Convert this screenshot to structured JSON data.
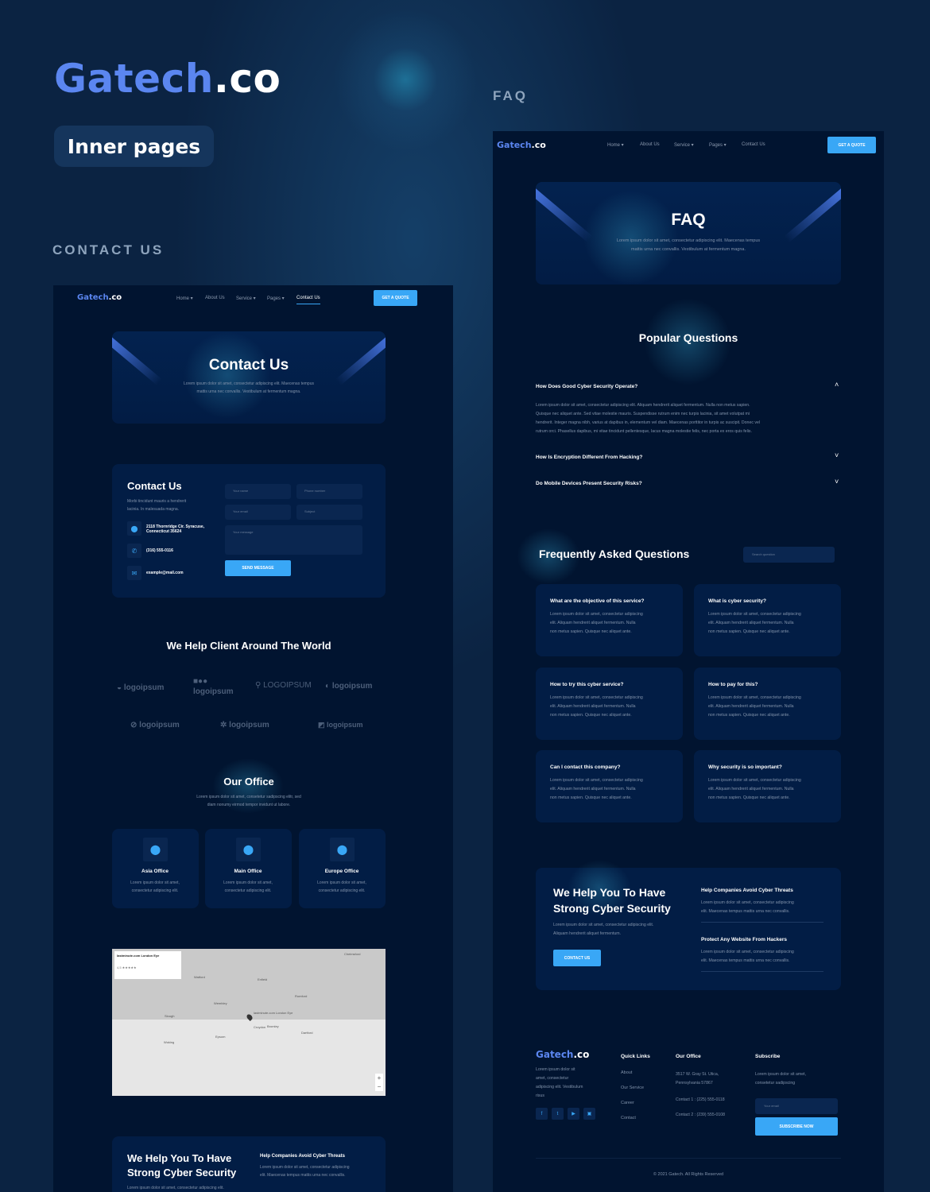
{
  "showcase": {
    "brand_a": "Gatech",
    "brand_b": ".co",
    "badge": "Inner pages",
    "section_contact": "CONTACT US",
    "section_faq": "FAQ"
  },
  "colors": {
    "accent": "#39a7f6",
    "brand_blue": "#5b86f0",
    "bg": "#011430",
    "card": "#021d45"
  },
  "nav": {
    "logo_a": "Gatech",
    "logo_b": ".co",
    "items": [
      "Home",
      "About Us",
      "Service",
      "Pages",
      "Contact Us"
    ],
    "cta": "GET A QUOTE"
  },
  "contact": {
    "hero_title": "Contact Us",
    "hero_text_1": "Lorem ipsum dolor sit amet, consectetur adipiscing elit. Maecenas tempus",
    "hero_text_2": "mattis urna nec convallis. Vestibulum at fermentum magna.",
    "form_title": "Contact Us",
    "form_text_1": "Morbi tincidunt mauris a hendrerit",
    "form_text_2": "lacinia. In malesuada magna.",
    "address_1": "2118 Thornridge Cir. Syracuse,",
    "address_2": "Connecticut 35624",
    "phone": "(316) 555-0116",
    "email": "example@mail.com",
    "ph_name": "Your name",
    "ph_phone": "Phone number",
    "ph_email": "Your email",
    "ph_subject": "Subject",
    "ph_message": "Your message",
    "send": "SEND MESSAGE",
    "clients_title": "We Help Client Around The World",
    "logos": [
      "logoipsum",
      "logoipsum",
      "LOGOIPSUM",
      "logoipsum",
      "logoipsum",
      "logoipsum",
      "logoipsum"
    ],
    "office_title": "Our Office",
    "office_text_1": "Lorem ipsum dolor sit amet, consetetur sadipscing elitr, sed",
    "office_text_2": "diam nonumy eirmod tempor invidunt ut labore.",
    "offices": [
      {
        "name": "Asia Office",
        "t1": "Lorem ipsum dolor sit amet,",
        "t2": "consectetur adipiscing elit."
      },
      {
        "name": "Main Office",
        "t1": "Lorem ipsum dolor sit amet,",
        "t2": "consectetur adipiscing elit."
      },
      {
        "name": "Europe Office",
        "t1": "Lorem ipsum dolor sit amet,",
        "t2": "consectetur adipiscing elit."
      }
    ],
    "map": {
      "place": "lastminute.com London Eye",
      "rating": "4,5 ★★★★★",
      "labels": [
        "Watford",
        "Enfield",
        "Wembley",
        "Slough",
        "Romford",
        "Croydon",
        "Bromley",
        "Dartford",
        "Chelmsford",
        "Woking",
        "Epsom",
        "lastminute.com London Eye"
      ]
    },
    "promo_title_1": "We Help You To Have",
    "promo_title_2": "Strong Cyber Security",
    "promo_text": "Lorem ipsum dolor sit amet, consectetur adipiscing elit.",
    "promo_h1": "Help Companies Avoid Cyber Threats",
    "promo_h1_t1": "Lorem ipsum dolor sit amet, consectetur adipiscing",
    "promo_h1_t2": "elit. Maecenas tempus mattis urna nec convallis."
  },
  "faq": {
    "hero_title": "FAQ",
    "hero_text_1": "Lorem ipsum dolor sit amet, consectetur adipiscing elit. Maecenas tempus",
    "hero_text_2": "mattis urna nec convallis. Vestibulum at fermentum magna.",
    "popular_title": "Popular Questions",
    "accordion": [
      {
        "q": "How Does Good Cyber Security Operate?",
        "open": true,
        "a": [
          "Lorem ipsum dolor sit amet, consectetur adipiscing elit. Aliquam hendrerit aliquet fermentum. Nulla non metus sapien.",
          "Quisque nec aliquet ante. Sed vitae molestie mauris. Suspendisse rutrum enim nec turpis lacinia, sit amet volutpat mi",
          "hendrerit. Integer magna nibh, varius at dapibus in, elementum vel diam. Maecenas porttitor in turpis ac suscipit. Donec vel",
          "rutrum orci. Phasellus dapibus, mi vitae tincidunt pellentesque, lacus magna molestie felis, nec porta ex eros quis felis."
        ]
      },
      {
        "q": "How Is Encryption Different From Hacking?",
        "open": false
      },
      {
        "q": "Do Mobile Devices Present Security Risks?",
        "open": false
      }
    ],
    "faq_title": "Frequently Asked Questions",
    "search_ph": "Search question",
    "cards": [
      {
        "q": "What are the objective of this service?"
      },
      {
        "q": "What is cyber security?"
      },
      {
        "q": "How to try this cyber service?"
      },
      {
        "q": "How to pay for this?"
      },
      {
        "q": "Can I contact this company?"
      },
      {
        "q": "Why security is so important?"
      }
    ],
    "card_text": [
      "Lorem ipsum dolor sit amet, consectetur adipiscing",
      "elit. Aliquam hendrerit aliquet fermentum. Nulla",
      "non metus sapien. Quisque nec aliquet ante."
    ],
    "promo_title_1": "We Help You To Have",
    "promo_title_2": "Strong Cyber Security",
    "promo_text_1": "Lorem ipsum dolor sit amet, consectetur adipiscing elit.",
    "promo_text_2": "Aliquam hendrerit aliquet fermentum.",
    "promo_btn": "CONTACT US",
    "promo_h1": "Help Companies Avoid Cyber Threats",
    "promo_h2": "Protect Any Website From Hackers",
    "promo_ht1": "Lorem ipsum dolor sit amet, consectetur adipiscing",
    "promo_ht2": "elit. Maecenas tempus mattis urna nec convallis.",
    "footer": {
      "about": [
        "Lorem ipsum dolor sit",
        "amet, consectetur",
        "adipiscing elit. Vestibulum",
        "risus"
      ],
      "quick_title": "Quick Links",
      "quick": [
        "About",
        "Our Service",
        "Career",
        "Contact"
      ],
      "office_title": "Our Office",
      "office_1": "3517 W. Gray St. Utica,",
      "office_2": "Pennsylvania 57867",
      "contact_1": "Contact 1 : (225) 555-0118",
      "contact_2": "Contact 2 : (239) 555-0108",
      "sub_title": "Subscribe",
      "sub_1": "Lorem ipsum dolor sit amet,",
      "sub_2": "consetetur sadipscing",
      "email_ph": "Your email",
      "sub_btn": "SUBSCRIBE NOW",
      "copyright": "© 2021 Gatech. All Rights Reserved",
      "social": [
        "facebook",
        "twitter",
        "youtube",
        "twitch"
      ]
    }
  }
}
